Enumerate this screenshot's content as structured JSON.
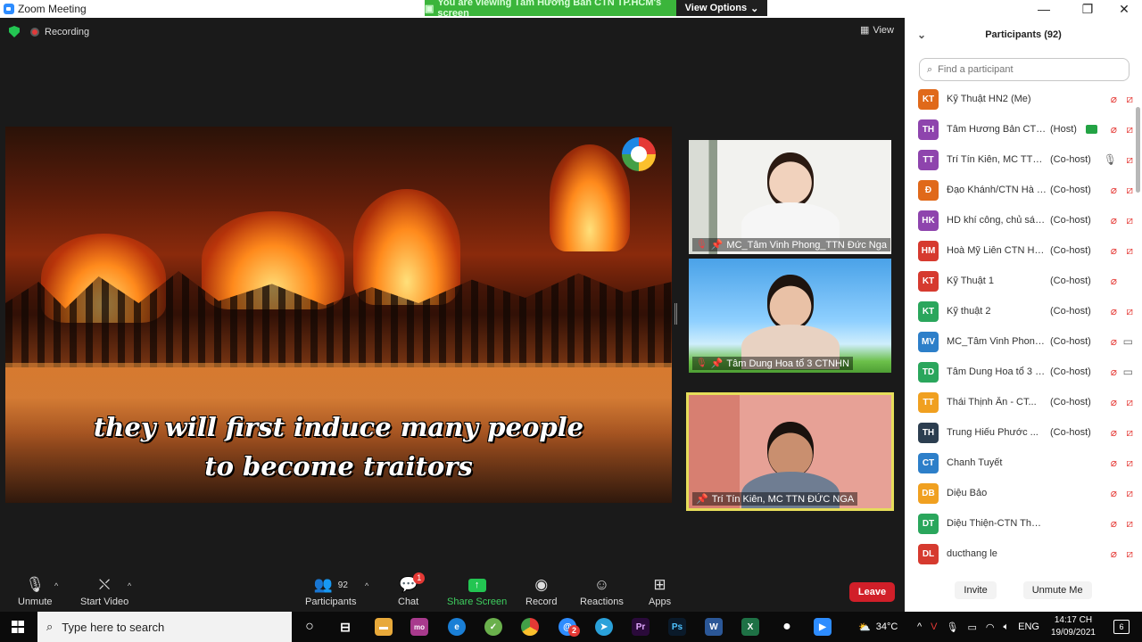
{
  "window": {
    "title": "Zoom Meeting"
  },
  "banner": {
    "message": "You are viewing Tâm Hương Bản CTN TP.HCM's screen",
    "options_label": "View Options"
  },
  "stage": {
    "recording_label": "Recording",
    "view_label": "View",
    "caption_line1": "they will first induce many people",
    "caption_line2": "to become traitors"
  },
  "tiles": [
    {
      "name": "MC_Tâm Vinh Phong_TTN Đức Nga"
    },
    {
      "name": "Tâm Dung Hoa tổ 3 CTNHN"
    },
    {
      "name": "Trí Tín Kiên, MC  TTN ĐỨC NGA"
    }
  ],
  "toolbar": {
    "unmute": "Unmute",
    "start_video": "Start Video",
    "participants": "Participants",
    "participants_count": "92",
    "chat": "Chat",
    "chat_badge": "1",
    "share_screen": "Share Screen",
    "record": "Record",
    "reactions": "Reactions",
    "apps": "Apps",
    "leave": "Leave"
  },
  "panel": {
    "title": "Participants (92)",
    "search_placeholder": "Find a participant",
    "invite": "Invite",
    "unmute_me": "Unmute Me",
    "participants": [
      {
        "initials": "KT",
        "color": "#e0691a",
        "name": "Kỹ Thuật HN2 (Me)",
        "role": "",
        "mic": "off",
        "video": "off"
      },
      {
        "initials": "TH",
        "color": "#8e44ad",
        "name": "Tâm Hương Bản CTN T...",
        "role": "(Host)",
        "mic": "off",
        "video": "off"
      },
      {
        "initials": "TT",
        "color": "#8e44ad",
        "name": "Trí Tín Kiên, MC  TTN Đ...",
        "role": "(Co-host)",
        "mic": "on",
        "video": "off"
      },
      {
        "initials": "Đ",
        "color": "#e0691a",
        "name": "Đạo Khánh/CTN Hà Nội",
        "role": "(Co-host)",
        "mic": "off",
        "video": "off"
      },
      {
        "initials": "HK",
        "color": "#8e44ad",
        "name": "HD khí công, chủ sám t...",
        "role": "(Co-host)",
        "mic": "off",
        "video": "off"
      },
      {
        "initials": "HM",
        "color": "#d63a2f",
        "name": "Hoà Mỹ Liên CTN Hà Nội",
        "role": "(Co-host)",
        "mic": "off",
        "video": "off"
      },
      {
        "initials": "KT",
        "color": "#d63a2f",
        "name": "Kỹ Thuật 1",
        "role": "(Co-host)",
        "mic": "off",
        "video": ""
      },
      {
        "initials": "KT",
        "color": "#2aa65c",
        "name": "Kỹ thuật 2",
        "role": "(Co-host)",
        "mic": "off",
        "video": "off"
      },
      {
        "initials": "MV",
        "color": "#2d7fc9",
        "name": "MC_Tâm Vinh Phong_T...",
        "role": "(Co-host)",
        "mic": "off",
        "video": "on"
      },
      {
        "initials": "TD",
        "color": "#2aa65c",
        "name": "Tâm Dung Hoa tổ 3 CT...",
        "role": "(Co-host)",
        "mic": "off",
        "video": "on"
      },
      {
        "initials": "TT",
        "color": "#f0a020",
        "name": "Thái Thịnh Ấn - CT...",
        "role": "(Co-host)",
        "mic": "off",
        "video": "off"
      },
      {
        "initials": "TH",
        "color": "#2c3e50",
        "name": "Trung Hiếu Phước ...",
        "role": "(Co-host)",
        "mic": "off",
        "video": "off"
      },
      {
        "initials": "CT",
        "color": "#2d7fc9",
        "name": "Chanh Tuyết",
        "role": "",
        "mic": "off",
        "video": "off"
      },
      {
        "initials": "DB",
        "color": "#f0a020",
        "name": "Diệu Bảo",
        "role": "",
        "mic": "off",
        "video": "off"
      },
      {
        "initials": "DT",
        "color": "#2aa65c",
        "name": "Diệu Thiện-CTN Thanh Hoá",
        "role": "",
        "mic": "off",
        "video": "off"
      },
      {
        "initials": "DL",
        "color": "#d63a2f",
        "name": "ducthang le",
        "role": "",
        "mic": "off",
        "video": "off"
      }
    ]
  },
  "taskbar": {
    "search_placeholder": "Type here to search",
    "weather": "34°C",
    "language": "ENG",
    "time": "14:17 CH",
    "date": "19/09/2021",
    "notifications": "6",
    "mail_badge": "2"
  }
}
